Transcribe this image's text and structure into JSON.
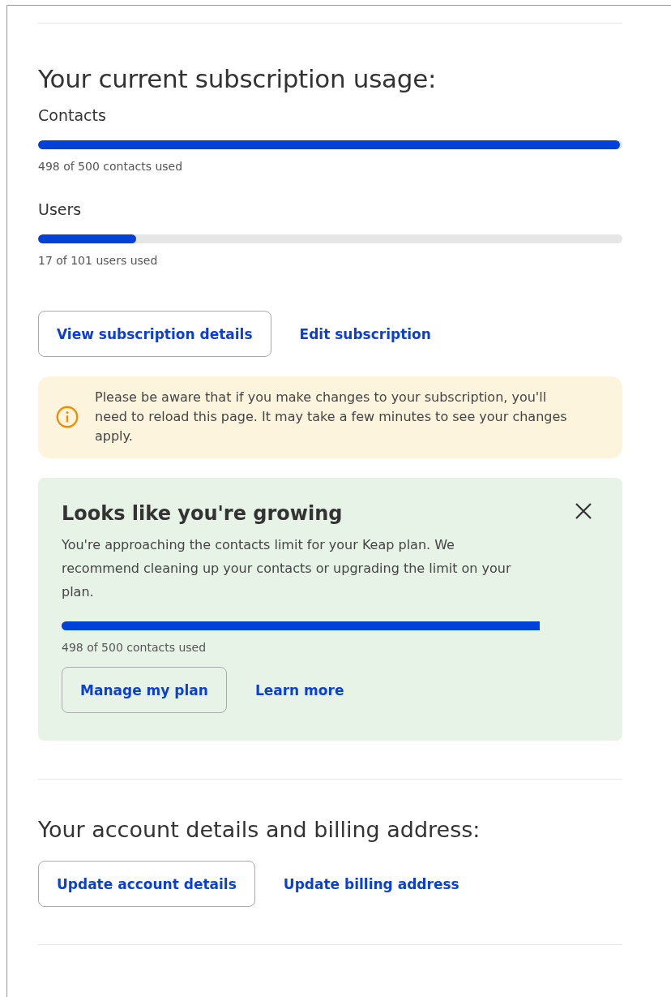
{
  "usage": {
    "title": "Your current subscription usage:",
    "meters": [
      {
        "label": "Contacts",
        "level": 0.996,
        "reading": "498 of 500 contacts used"
      },
      {
        "label": "Users",
        "level": 0.168,
        "reading": "17 of 101 users used"
      }
    ],
    "actions": [
      {
        "kind": "button",
        "label": "View subscription details"
      },
      {
        "kind": "link",
        "label": "Edit subscription"
      }
    ]
  },
  "notice": {
    "text": "Please be aware that if you make changes to your subscription, you'll need to reload this page. It may take a few minutes to see your changes apply."
  },
  "growth_card": {
    "title": "Looks like you're growing",
    "text": "You're approaching the contacts limit for your Keap plan. We recommend cleaning up your contacts or upgrading the limit on your plan.",
    "reading": "498 of 500 contacts used",
    "actions": [
      {
        "kind": "button",
        "label": "Manage my plan"
      },
      {
        "kind": "link",
        "label": "Learn more"
      }
    ]
  },
  "account": {
    "title": "Your account details and billing address:",
    "actions": [
      {
        "kind": "button",
        "label": "Update account details"
      },
      {
        "kind": "link",
        "label": "Update billing address"
      }
    ]
  }
}
